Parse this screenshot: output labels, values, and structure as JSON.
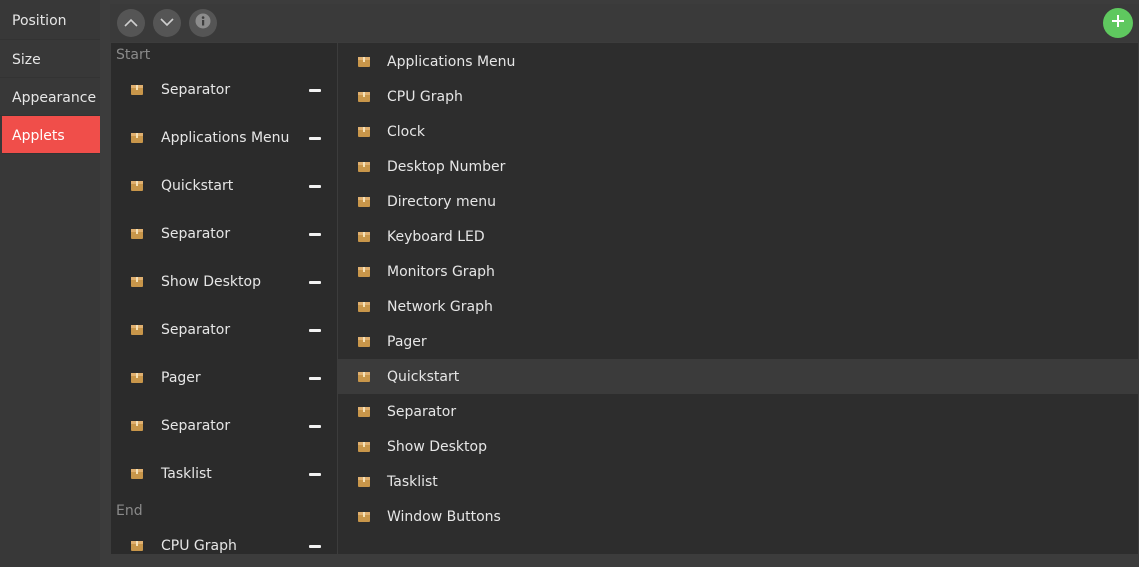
{
  "sidebar": {
    "items": [
      {
        "label": "Position"
      },
      {
        "label": "Size"
      },
      {
        "label": "Appearance"
      },
      {
        "label": "Applets",
        "active": true
      }
    ]
  },
  "toolbar": {
    "up_icon": "chevron-up-icon",
    "down_icon": "chevron-down-icon",
    "info_icon": "info-icon",
    "add_icon": "plus-icon",
    "add_color": "#5fc85f"
  },
  "placed": {
    "start_label": "Start",
    "start_items": [
      {
        "label": "Separator"
      },
      {
        "label": "Applications Menu"
      },
      {
        "label": "Quickstart"
      },
      {
        "label": "Separator"
      },
      {
        "label": "Show Desktop"
      },
      {
        "label": "Separator"
      },
      {
        "label": "Pager"
      },
      {
        "label": "Separator"
      },
      {
        "label": "Tasklist"
      }
    ],
    "end_label": "End",
    "end_items": [
      {
        "label": "CPU Graph"
      }
    ]
  },
  "available": {
    "items": [
      {
        "label": "Applications Menu"
      },
      {
        "label": "CPU Graph"
      },
      {
        "label": "Clock"
      },
      {
        "label": "Desktop Number"
      },
      {
        "label": "Directory menu"
      },
      {
        "label": "Keyboard LED"
      },
      {
        "label": "Monitors Graph"
      },
      {
        "label": "Network Graph"
      },
      {
        "label": "Pager"
      },
      {
        "label": "Quickstart",
        "highlighted": true
      },
      {
        "label": "Separator"
      },
      {
        "label": "Show Desktop"
      },
      {
        "label": "Tasklist"
      },
      {
        "label": "Window Buttons"
      }
    ]
  },
  "colors": {
    "accent": "#f04e4a",
    "package_icon": "#c8964a"
  }
}
